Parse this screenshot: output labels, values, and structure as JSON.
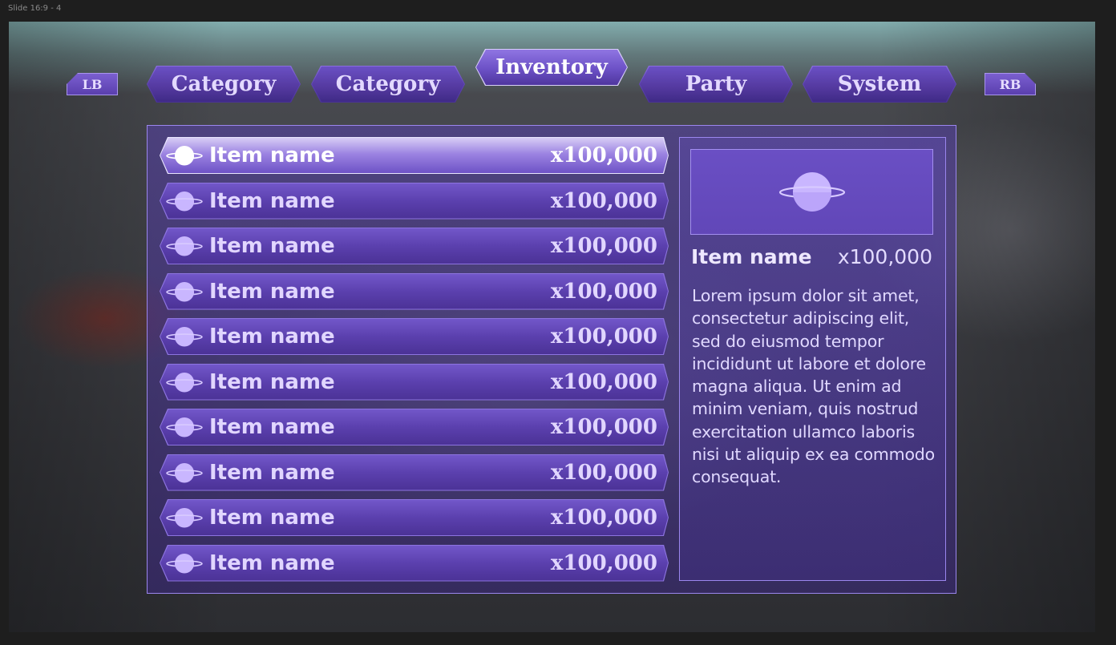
{
  "frame_label": "Slide 16:9 - 4",
  "bumpers": {
    "left": "LB",
    "right": "RB"
  },
  "tabs": [
    "Category",
    "Category",
    "Inventory",
    "Party",
    "System"
  ],
  "active_tab": "Inventory",
  "items": [
    {
      "name": "Item name",
      "qty": "x100,000"
    },
    {
      "name": "Item name",
      "qty": "x100,000"
    },
    {
      "name": "Item name",
      "qty": "x100,000"
    },
    {
      "name": "Item name",
      "qty": "x100,000"
    },
    {
      "name": "Item name",
      "qty": "x100,000"
    },
    {
      "name": "Item name",
      "qty": "x100,000"
    },
    {
      "name": "Item name",
      "qty": "x100,000"
    },
    {
      "name": "Item name",
      "qty": "x100,000"
    },
    {
      "name": "Item name",
      "qty": "x100,000"
    },
    {
      "name": "Item name",
      "qty": "x100,000"
    }
  ],
  "selected_item": 0,
  "detail": {
    "name": "Item name",
    "qty": "x100,000",
    "description": "Lorem ipsum dolor sit amet, consectetur adipiscing elit, sed do eiusmod  tempor incididunt ut labore et dolore magna aliqua. Ut enim ad minim  veniam, quis nostrud exercitation ullamco laboris nisi ut aliquip ex ea  commodo consequat.",
    "icon": "planet-icon"
  },
  "colors": {
    "accent": "#6a50c4",
    "accent_light": "#c9b6ff",
    "border": "#9b86ee"
  }
}
